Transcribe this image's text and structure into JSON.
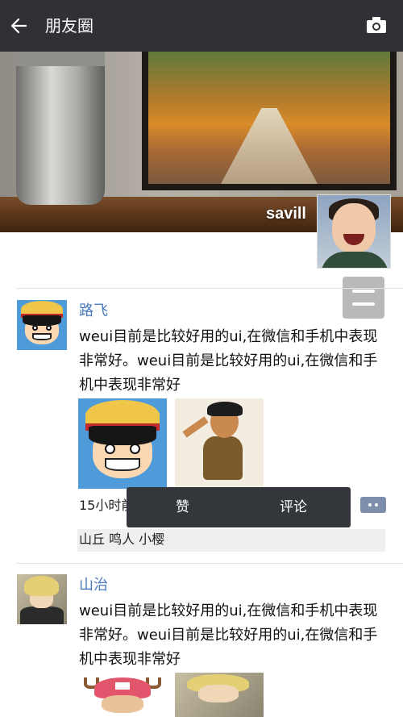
{
  "topbar": {
    "title": "朋友圈",
    "back_icon": "arrow-left-icon",
    "camera_icon": "camera-icon",
    "background": "#2f3137"
  },
  "cover": {
    "username": "savill"
  },
  "menu_icon": "menu-icon",
  "posts": [
    {
      "name": "路飞",
      "text": "weui目前是比较好用的ui,在微信和手机中表现非常好。weui目前是比较好用的ui,在微信和手机中表现非常好",
      "time": "15小时前",
      "actions": {
        "like": "赞",
        "comment": "评论"
      },
      "likes": "山丘 鸣人 小樱"
    },
    {
      "name": "山治",
      "text": "weui目前是比较好用的ui,在微信和手机中表现非常好。weui目前是比较好用的ui,在微信和手机中表现非常好"
    }
  ],
  "colors": {
    "name_link": "#4a7bbd",
    "popup_bg": "#33373c",
    "likes_bg": "#efefef"
  }
}
